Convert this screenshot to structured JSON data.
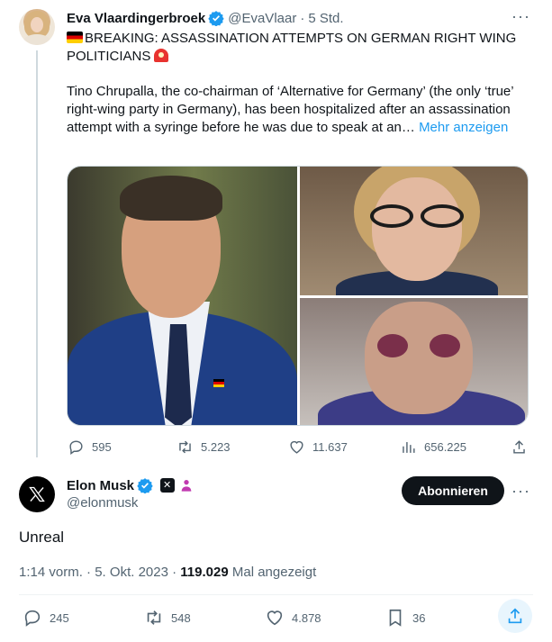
{
  "parent_tweet": {
    "author_name": "Eva Vlaardingerbroek",
    "author_handle": "@EvaVlaar",
    "separator": "·",
    "time": "5 Std.",
    "headline": "BREAKING: ASSASSINATION ATTEMPTS ON GERMAN RIGHT WING POLITICIANS",
    "body": "Tino Chrupalla, the co-chairman of ‘Alternative for Germany’ (the only ‘true’ right-wing party in Germany), has been hospitalized after an assassination attempt with a syringe before he was due to speak at an…",
    "show_more": "Mehr anzeigen",
    "replies": "595",
    "reposts": "5.223",
    "likes": "11.637",
    "views": "656.225"
  },
  "main_tweet": {
    "author_name": "Elon Musk",
    "author_handle": "@elonmusk",
    "follow_label": "Abonnieren",
    "text": "Unreal",
    "time": "1:14 vorm.",
    "date_sep": "·",
    "date": "5. Okt. 2023",
    "views_sep": "·",
    "views_count": "119.029",
    "views_label": "Mal angezeigt",
    "replies": "245",
    "reposts": "548",
    "likes": "4.878",
    "bookmarks": "36"
  },
  "colors": {
    "accent": "#1d9bf0",
    "text": "#0f1419",
    "muted": "#536471"
  },
  "icons": [
    "verified-badge-icon",
    "more-icon",
    "germany-flag-icon",
    "siren-icon",
    "reply-icon",
    "repost-icon",
    "like-icon",
    "views-icon",
    "share-icon",
    "bookmark-icon",
    "x-logo-icon",
    "x-affiliate-badge-icon",
    "government-badge-icon"
  ]
}
